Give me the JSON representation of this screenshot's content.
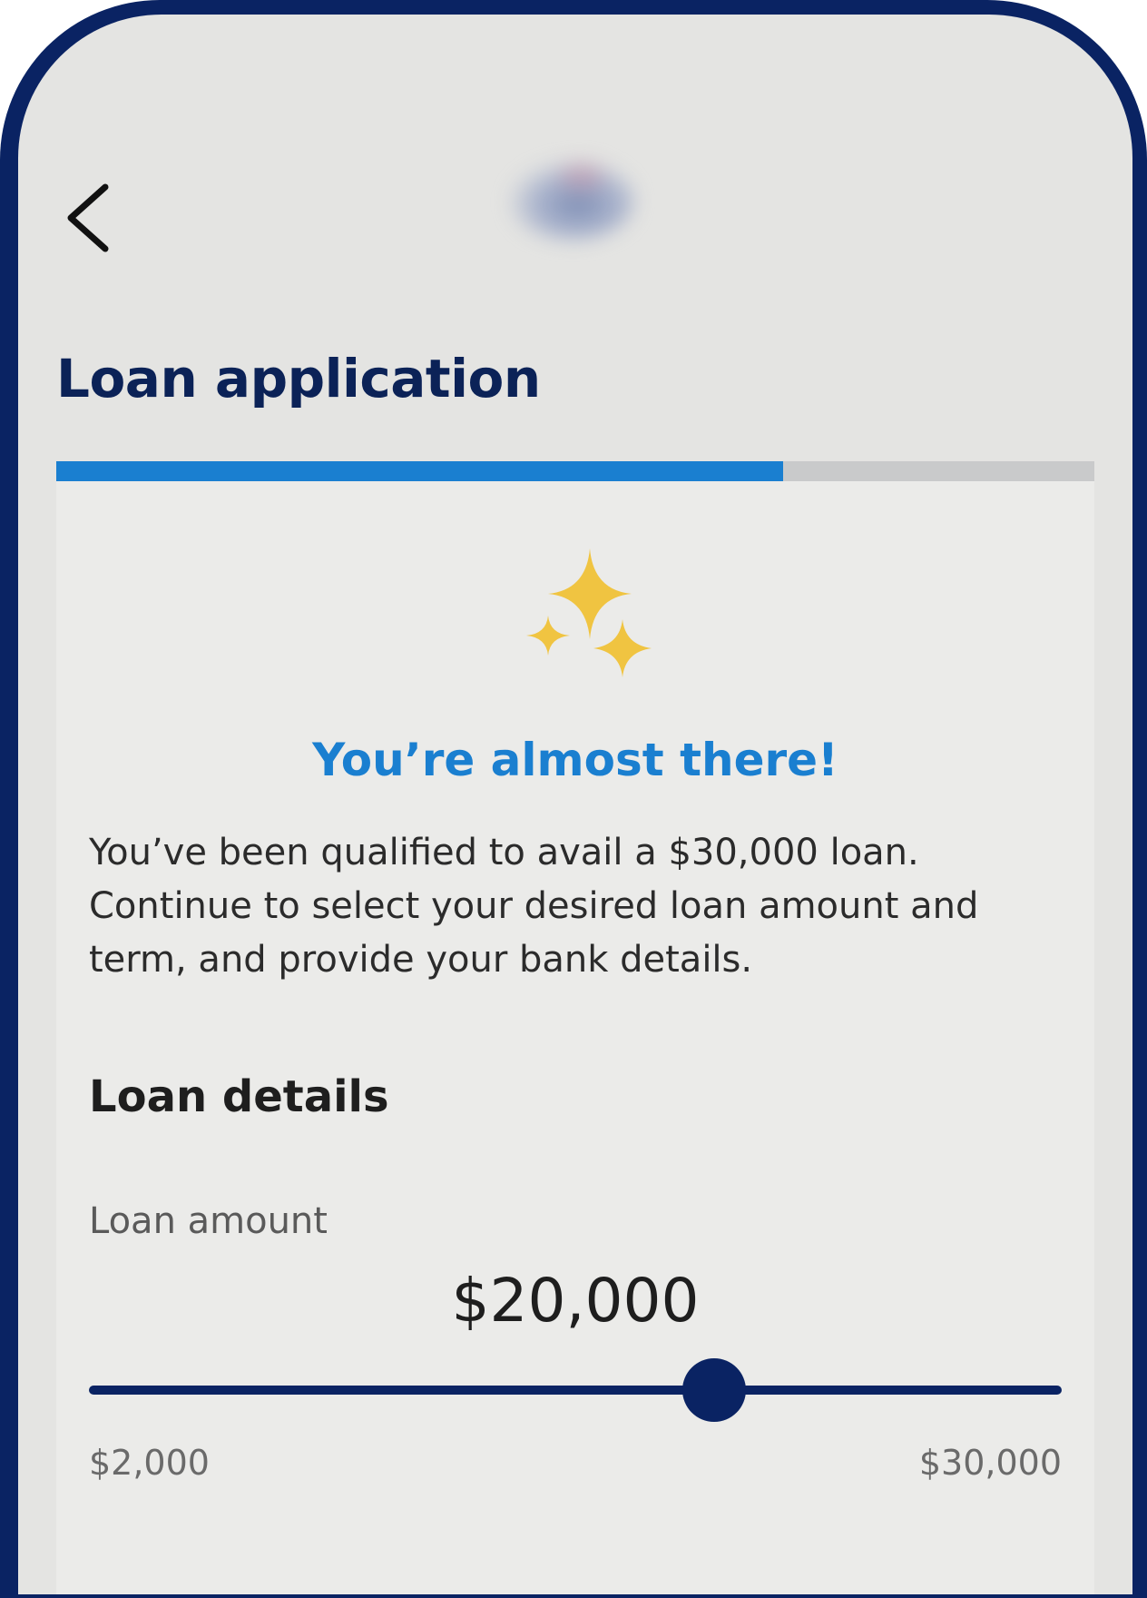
{
  "app": {
    "title": "Loan application",
    "progress_fraction": 0.7
  },
  "status": {
    "headline": "You’re almost there!",
    "message": "You’ve been qualified to avail a $30,000 loan. Continue to select your desired loan amount and term, and provide your bank details."
  },
  "loan_details": {
    "heading": "Loan details",
    "amount_label": "Loan amount",
    "amount_value": "$20,000",
    "slider": {
      "min_label": "$2,000",
      "max_label": "$30,000",
      "min": 2000,
      "max": 30000,
      "value": 20000
    }
  },
  "icons": {
    "back": "chevron-left-icon",
    "celebration": "sparkles-icon",
    "logo": "bank-logo-blurred"
  },
  "colors": {
    "brand_navy": "#0a2363",
    "accent_blue": "#1a7fd0",
    "sparkle_gold": "#f0c441",
    "screen_bg": "#e4e4e2",
    "card_bg": "#ebebe9"
  }
}
